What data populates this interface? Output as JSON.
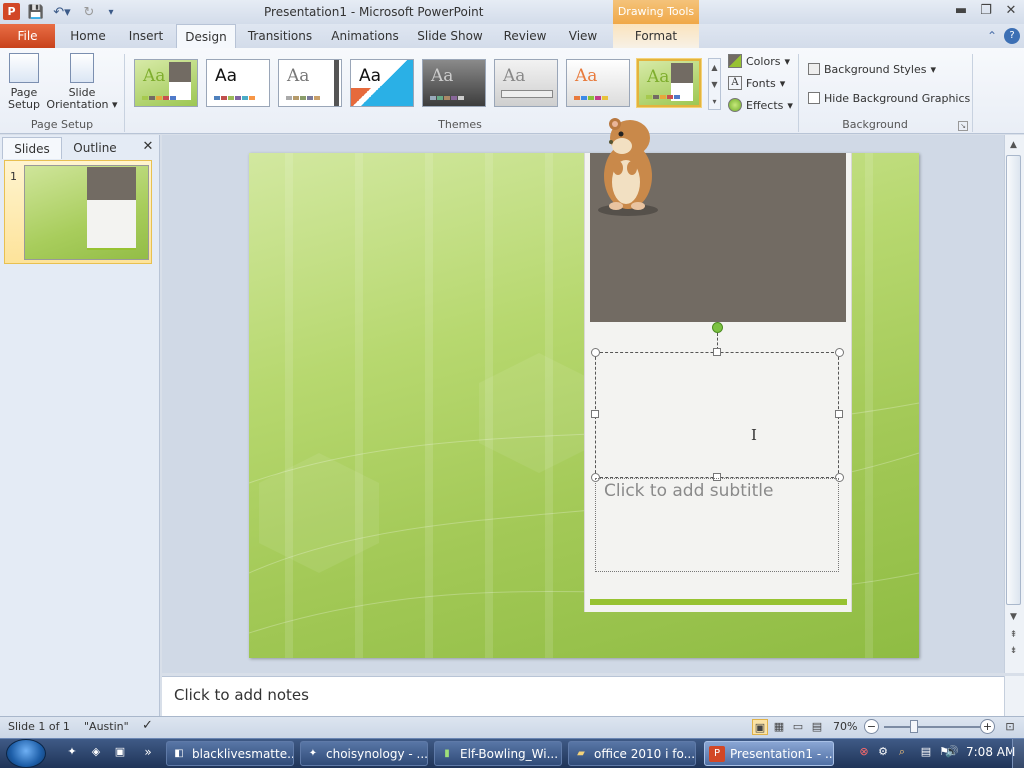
{
  "window": {
    "title": "Presentation1 - Microsoft PowerPoint",
    "contextual_tab_group": "Drawing Tools"
  },
  "tabs": {
    "file": "File",
    "items": [
      "Home",
      "Insert",
      "Design",
      "Transitions",
      "Animations",
      "Slide Show",
      "Review",
      "View",
      "Format"
    ],
    "active": "Design"
  },
  "ribbon": {
    "page_setup": {
      "page_setup_label_1": "Page",
      "page_setup_label_2": "Setup",
      "slide_orientation_label_1": "Slide",
      "slide_orientation_label_2": "Orientation",
      "group_label": "Page Setup"
    },
    "themes": {
      "group_label": "Themes",
      "thumb_text": "Aa",
      "selected_index": 7,
      "accent_colors": [
        "#a6c94f",
        "#ffffff",
        "#2ab0e6",
        "#4d4d4d",
        "#e66a3c",
        "#97c232"
      ]
    },
    "design_options": {
      "colors": "Colors",
      "fonts": "Fonts",
      "effects": "Effects"
    },
    "background": {
      "background_styles": "Background Styles",
      "hide_background_graphics": "Hide Background Graphics",
      "group_label": "Background"
    }
  },
  "left_pane": {
    "tab_slides": "Slides",
    "tab_outline": "Outline",
    "slide_number": "1"
  },
  "slide": {
    "subtitle_placeholder": "Click to add subtitle"
  },
  "notes": {
    "placeholder": "Click to add notes"
  },
  "status": {
    "slide_info": "Slide 1 of 1",
    "theme_name": "\"Austin\"",
    "zoom": "70%"
  },
  "taskbar": {
    "items": [
      "blacklivesmatte...",
      "choisynology - ...",
      "Elf-Bowling_Wi...",
      "office 2010 i fo...",
      "Presentation1 - ..."
    ],
    "active_index": 4,
    "clock": "7:08 AM"
  }
}
